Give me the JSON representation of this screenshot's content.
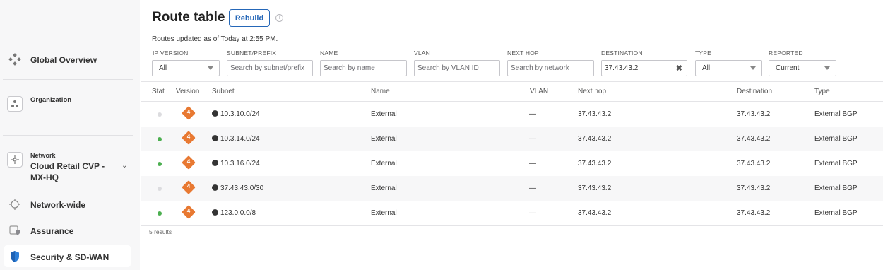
{
  "sidebar": {
    "global_overview": "Global Overview",
    "organization": "Organization",
    "network_caption": "Network",
    "network_name": "Cloud Retail CVP - MX-HQ",
    "network_wide": "Network-wide",
    "assurance": "Assurance",
    "security": "Security & SD-WAN"
  },
  "header": {
    "title": "Route table",
    "rebuild": "Rebuild",
    "updated": "Routes updated as of Today at 2:55 PM."
  },
  "filters": {
    "ip_version": {
      "label": "IP VERSION",
      "value": "All"
    },
    "subnet": {
      "label": "SUBNET/PREFIX",
      "placeholder": "Search by subnet/prefix"
    },
    "name": {
      "label": "NAME",
      "placeholder": "Search by name"
    },
    "vlan": {
      "label": "VLAN",
      "placeholder": "Search by VLAN ID"
    },
    "next_hop": {
      "label": "NEXT HOP",
      "placeholder": "Search by network"
    },
    "destination": {
      "label": "DESTINATION",
      "value": "37.43.43.2"
    },
    "type": {
      "label": "TYPE",
      "value": "All"
    },
    "reported": {
      "label": "REPORTED",
      "value": "Current"
    }
  },
  "table": {
    "columns": [
      "Stat",
      "Version",
      "Subnet",
      "Name",
      "VLAN",
      "Next hop",
      "Destination",
      "Type"
    ],
    "rows": [
      {
        "status": "inactive",
        "version": "4",
        "subnet": "10.3.10.0/24",
        "name": "External",
        "vlan": "—",
        "next_hop": "37.43.43.2",
        "destination": "37.43.43.2",
        "type": "External BGP"
      },
      {
        "status": "active",
        "version": "4",
        "subnet": "10.3.14.0/24",
        "name": "External",
        "vlan": "—",
        "next_hop": "37.43.43.2",
        "destination": "37.43.43.2",
        "type": "External BGP"
      },
      {
        "status": "active",
        "version": "4",
        "subnet": "10.3.16.0/24",
        "name": "External",
        "vlan": "—",
        "next_hop": "37.43.43.2",
        "destination": "37.43.43.2",
        "type": "External BGP"
      },
      {
        "status": "inactive",
        "version": "4",
        "subnet": "37.43.43.0/30",
        "name": "External",
        "vlan": "—",
        "next_hop": "37.43.43.2",
        "destination": "37.43.43.2",
        "type": "External BGP"
      },
      {
        "status": "active",
        "version": "4",
        "subnet": "123.0.0.0/8",
        "name": "External",
        "vlan": "—",
        "next_hop": "37.43.43.2",
        "destination": "37.43.43.2",
        "type": "External BGP"
      }
    ],
    "results": "5 results"
  },
  "colors": {
    "active": "#4caf50",
    "inactive": "#dcdcdf",
    "accent": "#2567b8",
    "version_badge": "#e87932"
  }
}
